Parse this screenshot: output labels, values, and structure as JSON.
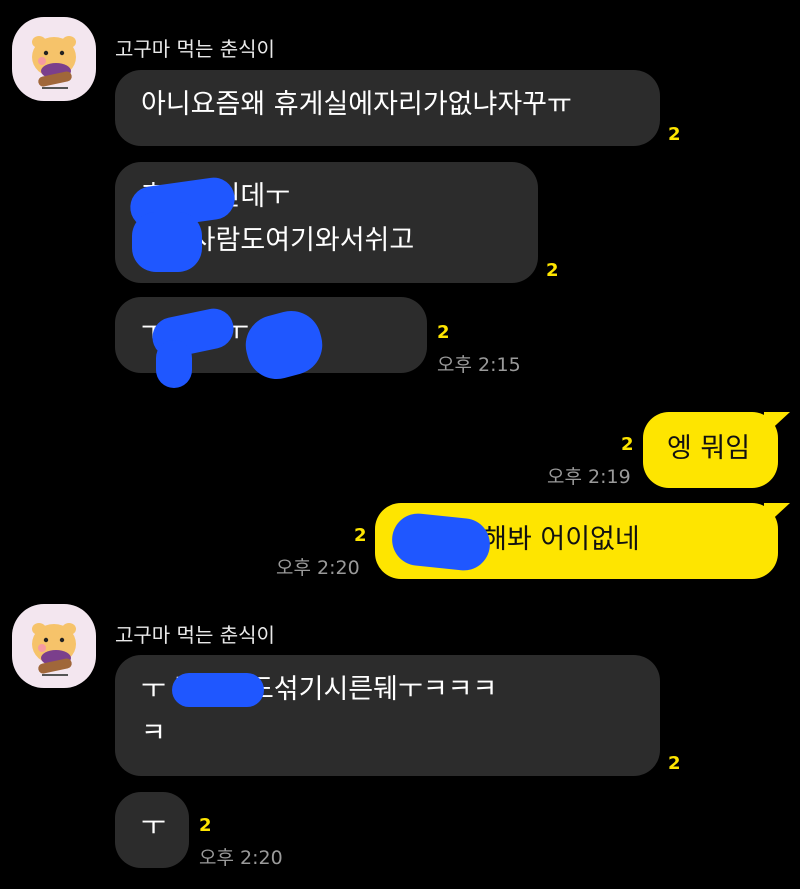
{
  "sender_name": "고구마 먹는 춘식이",
  "colors": {
    "background": "#000000",
    "incoming": "#2c2c2c",
    "outgoing": "#fee500",
    "unread": "#fee500",
    "redaction": "#1f57ff"
  },
  "messages": [
    {
      "direction": "in",
      "lines": [
        "아니요즘왜 휴게실에자리가없냐자꾸ㅠ"
      ],
      "unread": "2"
    },
    {
      "direction": "in",
      "lines": [
        "     휴게실인데ㅜ",
        "     파는사람도여기와서쉬고"
      ],
      "unread": "2"
    },
    {
      "direction": "in",
      "lines": [
        "ㅜ           인가ㅜ"
      ],
      "unread": "2",
      "time": "오후 2:15"
    },
    {
      "direction": "out",
      "lines": [
        "엥 뭐임"
      ],
      "unread": "2",
      "time": "오후 2:19"
    },
    {
      "direction": "out",
      "lines": [
        "      한테 말해봐 어이없네"
      ],
      "unread": "2",
      "time": "오후 2:20"
    },
    {
      "direction": "in",
      "lines": [
        "ㅜ       랑은말도섞기시른뒈ㅜㅋㅋㅋ",
        "ㅋ"
      ],
      "unread": "2"
    },
    {
      "direction": "in",
      "lines": [
        "ㅜ"
      ],
      "unread": "2",
      "time": "오후 2:20"
    }
  ],
  "icons": {
    "avatar": "chunsik-sweet-potato-avatar"
  }
}
